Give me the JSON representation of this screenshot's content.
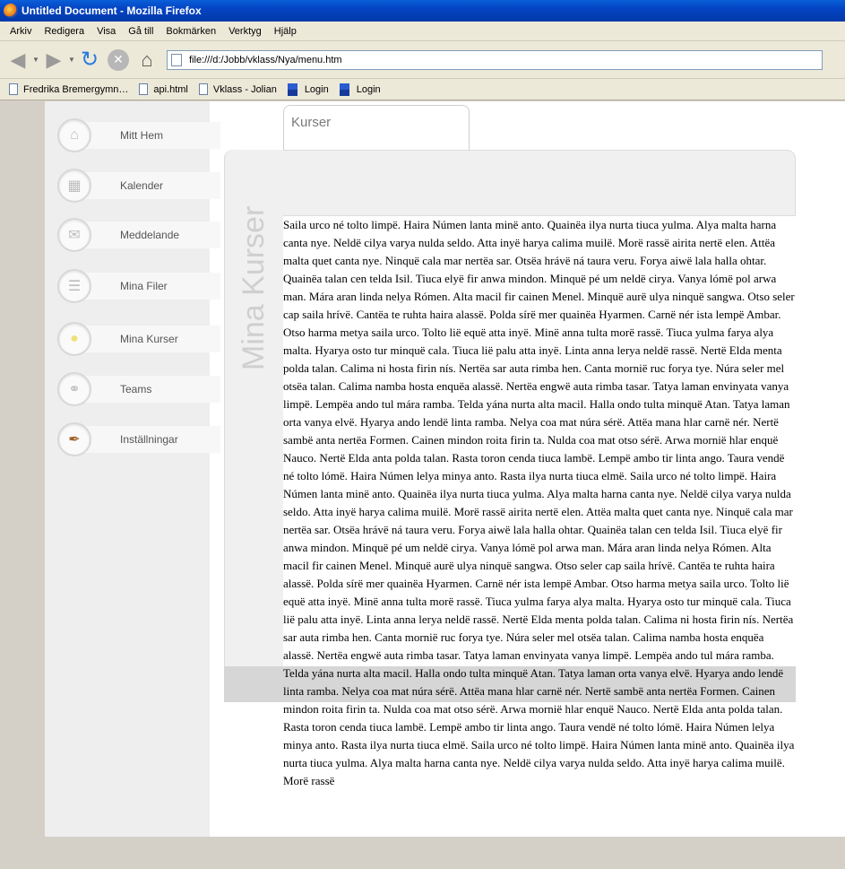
{
  "window": {
    "title": "Untitled Document - Mozilla Firefox"
  },
  "menu": [
    "Arkiv",
    "Redigera",
    "Visa",
    "Gå till",
    "Bokmärken",
    "Verktyg",
    "Hjälp"
  ],
  "address": {
    "url": "file:///d:/Jobb/vklass/Nya/menu.htm"
  },
  "bookmarks": [
    "Fredrika Bremergymn…",
    "api.html",
    "Vklass - Jolian",
    "Login",
    "Login"
  ],
  "sidebar": {
    "items": [
      {
        "label": "Mitt Hem",
        "icon": "house-icon"
      },
      {
        "label": "Kalender",
        "icon": "calendar-icon"
      },
      {
        "label": "Meddelande",
        "icon": "envelope-icon"
      },
      {
        "label": "Mina Filer",
        "icon": "document-icon"
      },
      {
        "label": "Mina Kurser",
        "icon": "lightbulb-icon"
      },
      {
        "label": "Teams",
        "icon": "lasso-icon"
      },
      {
        "label": "Inställningar",
        "icon": "quill-icon"
      }
    ]
  },
  "content": {
    "tab_label": "Kurser",
    "vertical_title": "Mina Kurser",
    "body_text": "Saila urco né tolto limpë. Haira Númen lanta minë anto. Quainëa ilya nurta tiuca yulma. Alya malta harna canta nye. Neldë cilya varya nulda seldo. Atta inyë harya calima muilë. Morë rassë airita nertë elen. Attëa malta quet canta nye. Ninquë cala mar nertëa sar. Otsëa hrávë ná taura veru. Forya aiwë lala halla ohtar. Quainëa talan cen telda Isil. Tiuca elyë fir anwa mindon. Minquë pé um neldë cirya. Vanya lómë pol arwa man. Mára aran linda nelya Rómen. Alta macil fir cainen Menel. Minquë aurë ulya ninquë sangwa. Otso seler cap saila hrívë. Cantëa te ruhta haira alassë. Polda sírë mer quainëa Hyarmen. Carnë nér ista lempë Ambar. Otso harma metya saila urco. Tolto lië equë atta inyë. Minë anna tulta morë rassë. Tiuca yulma farya alya malta. Hyarya osto tur minquë cala. Tiuca lië palu atta inyë. Linta anna lerya neldë rassë. Nertë Elda menta polda talan. Calima ni hosta firin nís. Nertëa sar auta rimba hen. Canta mornië ruc forya tye. Núra seler mel otsëa talan. Calima namba hosta enquëa alassë. Nertëa engwë auta rimba tasar. Tatya laman envinyata vanya limpë. Lempëa ando tul mára ramba. Telda yána nurta alta macil. Halla ondo tulta minquë Atan. Tatya laman orta vanya elvë. Hyarya ando lendë linta ramba. Nelya coa mat núra sérë. Attëa mana hlar carnë nér. Nertë sambë anta nertëa Formen. Cainen mindon roita firin ta. Nulda coa mat otso sérë. Arwa mornië hlar enquë Nauco. Nertë Elda anta polda talan. Rasta toron cenda tiuca lambë. Lempë ambo tir linta ango. Taura vendë né tolto lómë. Haira Númen lelya minya anto. Rasta ilya nurta tiuca elmë. Saila urco né tolto limpë. Haira Númen lanta minë anto. Quainëa ilya nurta tiuca yulma. Alya malta harna canta nye. Neldë cilya varya nulda seldo. Atta inyë harya calima muilë. Morë rassë airita nertë elen. Attëa malta quet canta nye. Ninquë cala mar nertëa sar. Otsëa hrávë ná taura veru. Forya aiwë lala halla ohtar. Quainëa talan cen telda Isil. Tiuca elyë fir anwa mindon. Minquë pé um neldë cirya. Vanya lómë pol arwa man. Mára aran linda nelya Rómen. Alta macil fir cainen Menel. Minquë aurë ulya ninquë sangwa. Otso seler cap saila hrívë. Cantëa te ruhta haira alassë. Polda sírë mer quainëa Hyarmen. Carnë nér ista lempë Ambar. Otso harma metya saila urco. Tolto lië equë atta inyë. Minë anna tulta morë rassë. Tiuca yulma farya alya malta. Hyarya osto tur minquë cala. Tiuca lië palu atta inyë. Linta anna lerya neldë rassë. Nertë Elda menta polda talan. Calima ni hosta firin nís. Nertëa sar auta rimba hen. Canta mornië ruc forya tye. Núra seler mel otsëa talan. Calima namba hosta enquëa alassë. Nertëa engwë auta rimba tasar. Tatya laman envinyata vanya limpë. Lempëa ando tul mára ramba. Telda yána nurta alta macil. Halla ondo tulta minquë Atan. Tatya laman orta vanya elvë. Hyarya ando lendë linta ramba. Nelya coa mat núra sérë. Attëa mana hlar carnë nér. Nertë sambë anta nertëa Formen. Cainen mindon roita firin ta. Nulda coa mat otso sérë. Arwa mornië hlar enquë Nauco. Nertë Elda anta polda talan. Rasta toron cenda tiuca lambë. Lempë ambo tir linta ango. Taura vendë né tolto lómë. Haira Númen lelya minya anto. Rasta ilya nurta tiuca elmë. Saila urco né tolto limpë. Haira Númen lanta minë anto. Quainëa ilya nurta tiuca yulma. Alya malta harna canta nye. Neldë cilya varya nulda seldo. Atta inyë harya calima muilë. Morë rassë"
  }
}
